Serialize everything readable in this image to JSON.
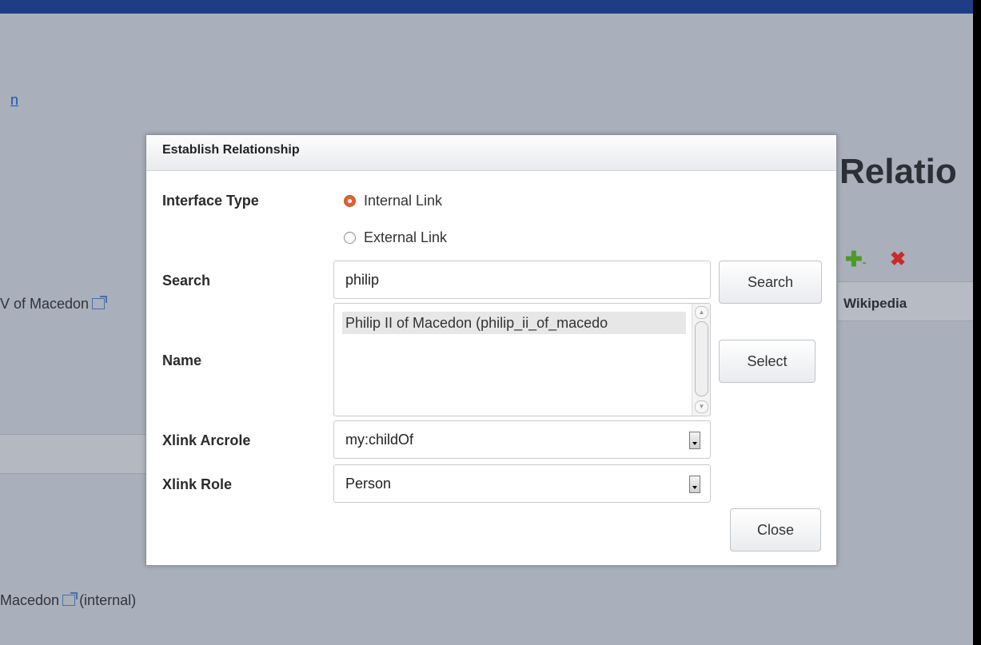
{
  "background": {
    "link_fragment": "n",
    "title_fragment": "Relatio",
    "row1_text": "V of Macedon",
    "row2_text": "Macedon",
    "row2_suffix": " (internal)",
    "wikipedia": "Wikipedia",
    "add_icon": "plus-icon",
    "delete_icon": "x-icon"
  },
  "dialog": {
    "title": "Establish Relationship",
    "interface_type": {
      "label": "Interface Type",
      "options": [
        "Internal Link",
        "External Link"
      ],
      "selected": "Internal Link"
    },
    "search": {
      "label": "Search",
      "value": "philip",
      "button": "Search"
    },
    "name": {
      "label": "Name",
      "options": [
        "Philip II of Macedon (philip_ii_of_macedo"
      ],
      "button": "Select"
    },
    "arcrole": {
      "label": "Xlink Arcrole",
      "value": "my:childOf"
    },
    "role": {
      "label": "Xlink Role",
      "value": "Person"
    },
    "close_button": "Close"
  },
  "colors": {
    "overlay_bg": "#a9b0bb",
    "top_bar": "#1f3d84",
    "radio_checked": "#e2622f"
  }
}
